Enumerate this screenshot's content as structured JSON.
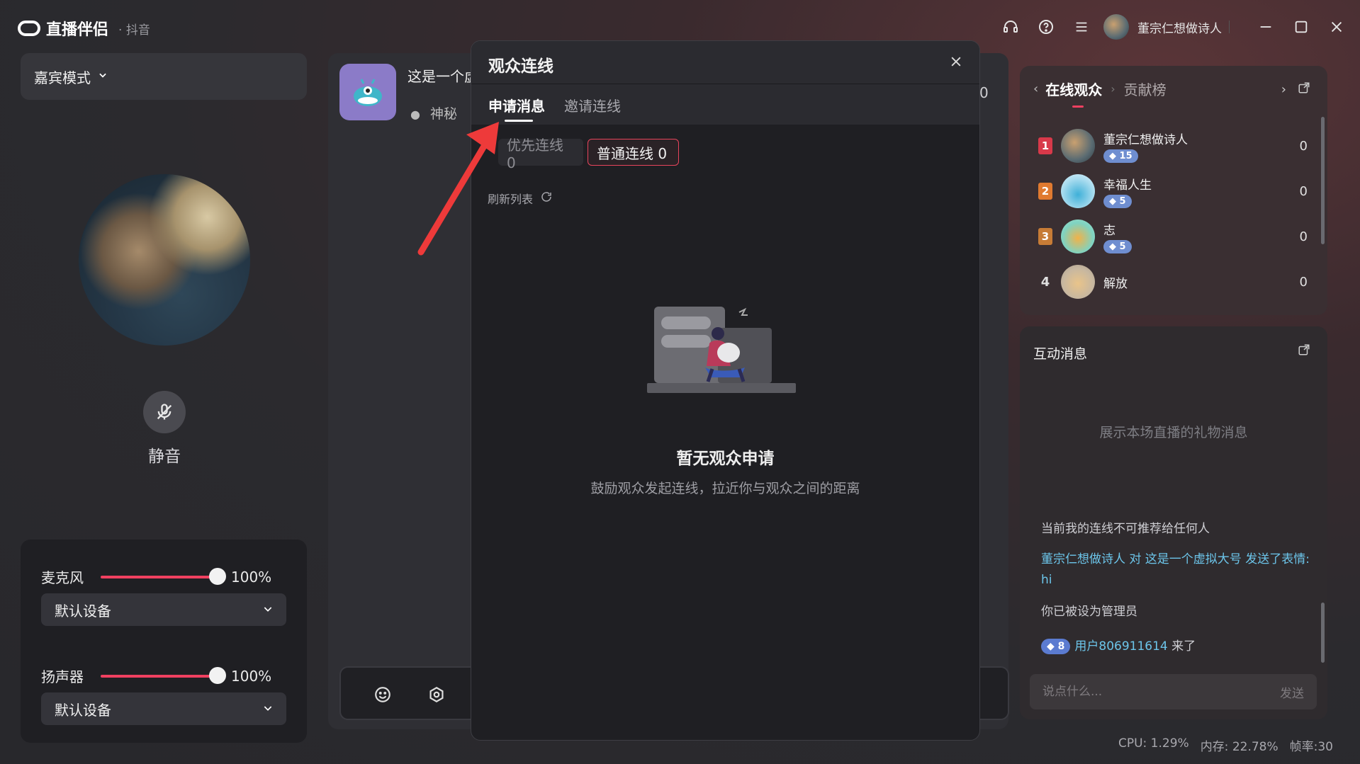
{
  "app": {
    "title": "直播伴侣",
    "platform": "· 抖音"
  },
  "titlebar": {
    "username": "董宗仁想做诗人"
  },
  "left": {
    "mode_label": "嘉宾模式",
    "mute_label": "静音",
    "microphone": {
      "label": "麦克风",
      "level": 1.0,
      "percent": "100%",
      "device": "默认设备"
    },
    "speaker": {
      "label": "扬声器",
      "level": 1.0,
      "percent": "100%",
      "device": "默认设备"
    }
  },
  "stream": {
    "title": "这是一个虚拟大号",
    "location": "神秘",
    "viewer_count": "0"
  },
  "modal": {
    "title": "观众连线",
    "tabs": [
      {
        "label": "申请消息",
        "active": true
      },
      {
        "label": "邀请连线",
        "active": false
      }
    ],
    "filters": {
      "priority": "优先连线 0",
      "normal": "普通连线 0"
    },
    "refresh_label": "刷新列表",
    "empty_title": "暂无观众申请",
    "empty_subtitle": "鼓励观众发起连线，拉近你与观众之间的距离"
  },
  "viewers_panel": {
    "tab_online": "在线观众",
    "tab_contrib": "贡献榜",
    "rows": [
      {
        "rank": "1",
        "name": "董宗仁想做诗人",
        "level": "15",
        "score": "0"
      },
      {
        "rank": "2",
        "name": "幸福人生",
        "level": "5",
        "score": "0"
      },
      {
        "rank": "3",
        "name": "志",
        "level": "5",
        "score": "0"
      },
      {
        "rank": "4",
        "name": "解放",
        "level": "",
        "score": "0"
      }
    ]
  },
  "messages_panel": {
    "title": "互动消息",
    "gift_placeholder": "展示本场直播的礼物消息",
    "messages": [
      "当前我的连线不可推荐给任何人",
      "董宗仁想做诗人 对 这是一个虚拟大号 发送了表情: hi",
      "你已被设为管理员"
    ],
    "join_msg": {
      "level": "8",
      "user": "用户806911614",
      "text": " 来了"
    },
    "input_placeholder": "说点什么...",
    "send_label": "发送"
  },
  "status": {
    "cpu": "CPU: 1.29%",
    "memory": "内存: 22.78%",
    "fps": "帧率:30"
  },
  "colors": {
    "accent": "#f04060",
    "link": "#6cc5ea",
    "badge": "#6f8ed0"
  }
}
